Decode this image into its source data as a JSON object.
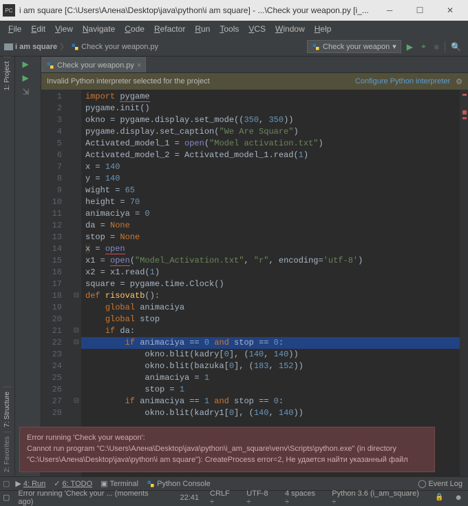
{
  "window": {
    "title": "i am square [C:\\Users\\Алена\\Desktop\\java\\python\\i am square] - ...\\Check your weapon.py [i_...",
    "project": "i am square"
  },
  "menu": [
    "File",
    "Edit",
    "View",
    "Navigate",
    "Code",
    "Refactor",
    "Run",
    "Tools",
    "VCS",
    "Window",
    "Help"
  ],
  "breadcrumbs": {
    "project": "i am square",
    "file": "Check your weapon.py"
  },
  "run_config": "Check your weapon",
  "tab": {
    "name": "Check your weapon.py"
  },
  "warning": {
    "text": "Invalid Python interpreter selected for the project",
    "action": "Configure Python interpreter"
  },
  "left_tool": {
    "project": "1: Project",
    "structure": "7: Structure",
    "favorites": "2: Favorites"
  },
  "code_lines": [
    {
      "n": 1,
      "html": "<span class='kw'>import</span> <span class='under-red'>pygame</span>"
    },
    {
      "n": 2,
      "html": "pygame.init()"
    },
    {
      "n": 3,
      "html": "okno = pygame.display.set_mode((<span class='num'>350</span>, <span class='num'>350</span>))"
    },
    {
      "n": 4,
      "html": "pygame.display.set_caption(<span class='str'>\"We Are Square\"</span>)"
    },
    {
      "n": 5,
      "html": "Activated_model_1 = <span class='builtin'>open</span>(<span class='str'>\"Model activation.txt\"</span>)"
    },
    {
      "n": 6,
      "html": "Activated_model_2 = Activated_model_1.read(<span class='num'>1</span>)"
    },
    {
      "n": 7,
      "html": "x = <span class='num'>140</span>"
    },
    {
      "n": 8,
      "html": "y = <span class='num'>140</span>"
    },
    {
      "n": 9,
      "html": "wight = <span class='num'>65</span>"
    },
    {
      "n": 10,
      "html": "height = <span class='num'>70</span>"
    },
    {
      "n": 11,
      "html": "animaciya = <span class='num'>0</span>"
    },
    {
      "n": 12,
      "html": "da = <span class='kw'>None</span>"
    },
    {
      "n": 13,
      "html": "stop = <span class='kw'>None</span>"
    },
    {
      "n": 14,
      "html": "<span class='bg-highlight'>x</span> = <span class='builtin under-red'>open</span>"
    },
    {
      "n": 15,
      "html": "x1 = <span class='builtin under-red'>open</span>(<span class='str'>\"Model_Activation.txt\"</span>, <span class='str'>\"r\"</span>, <span class='op'>encoding=</span><span class='str'>'utf-8'</span>)"
    },
    {
      "n": 16,
      "html": "x2 = x1.read(<span class='num'>1</span>)"
    },
    {
      "n": 17,
      "html": "square = pygame.time.Clock()"
    },
    {
      "n": 18,
      "html": "<span class='kw'>def</span> <span class='fn'>risovatb</span>():",
      "fold": "start"
    },
    {
      "n": 19,
      "html": "    <span class='kw'>global</span> animaciya"
    },
    {
      "n": 20,
      "html": "    <span class='kw'>global</span> stop"
    },
    {
      "n": 21,
      "html": "    <span class='kw'>if</span> da:",
      "fold": "start"
    },
    {
      "n": 22,
      "html": "        <span class='kw'>if</span> animaciya == <span class='num'>0</span> <span class='kw'>and</span> stop == <span class='num'>0</span>:",
      "sel": true,
      "fold": "start"
    },
    {
      "n": 23,
      "html": "            okno.blit(kadry[<span class='num'>0</span>], (<span class='num'>140</span>, <span class='num'>140</span>))"
    },
    {
      "n": 24,
      "html": "            okno.blit(bazuka[<span class='num'>0</span>], (<span class='num'>183</span>, <span class='num'>152</span>))"
    },
    {
      "n": 25,
      "html": "            animaciya = <span class='num'>1</span>"
    },
    {
      "n": 26,
      "html": "            stop = <span class='num'>1</span>"
    },
    {
      "n": 27,
      "html": "        <span class='kw'>if</span> animaciya == <span class='num'>1</span> <span class='kw'>and</span> stop == <span class='num'>0</span>:",
      "fold": "start"
    },
    {
      "n": 28,
      "html": "            okno.blit(kadry1[<span class='num'>0</span>], (<span class='num'>140</span>, <span class='num'>140</span>))"
    }
  ],
  "error_popup": {
    "title": "Error running 'Check your weapon':",
    "body": "Cannot run program \"C:\\Users\\Алена\\Desktop\\java\\python\\i_am_square\\venv\\Scripts\\python.exe\" (in directory \"C:\\Users\\Алена\\Desktop\\java\\python\\i am square\"): CreateProcess error=2, Не удается найти указанный файл"
  },
  "bottom_tools": {
    "run": "4: Run",
    "todo": "6: TODO",
    "terminal": "Terminal",
    "console": "Python Console",
    "eventlog": "Event Log"
  },
  "statusbar": {
    "msg": "Error running 'Check your ... (moments ago)",
    "pos": "22:41",
    "eol": "CRLF",
    "enc": "UTF-8",
    "indent": "4 spaces",
    "interp": "Python 3.6 (i_am_square)"
  }
}
